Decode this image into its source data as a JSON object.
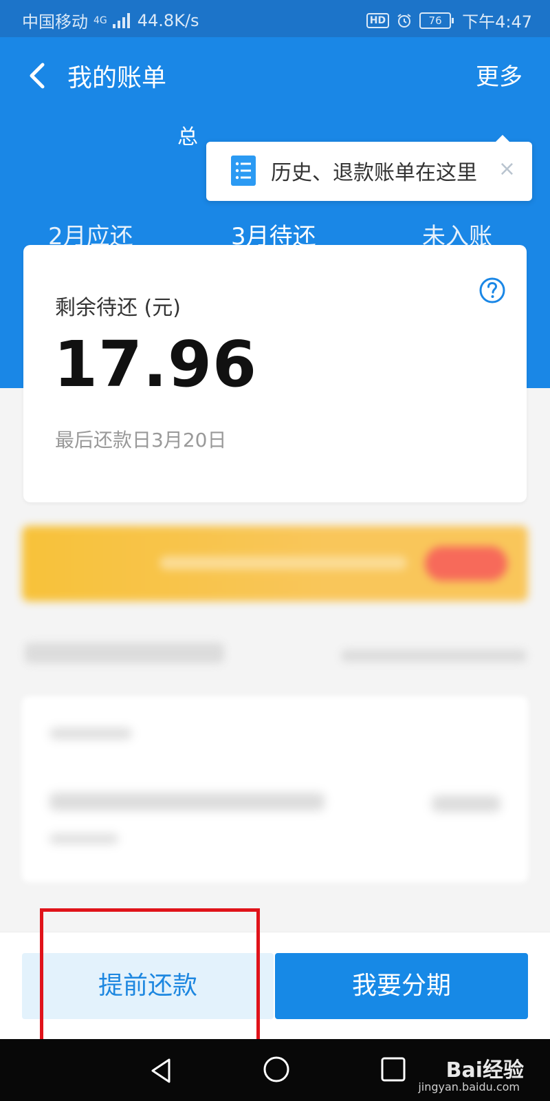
{
  "status_bar": {
    "carrier": "中国移动",
    "network": "4G",
    "speed": "44.8K/s",
    "hd": "HD",
    "battery": "76",
    "time": "下午4:47"
  },
  "header": {
    "title": "我的账单",
    "more": "更多",
    "total_fragment": "总"
  },
  "tooltip": {
    "text": "历史、退款账单在这里",
    "close": "×"
  },
  "tabs": [
    {
      "label": "2月应还"
    },
    {
      "label": "3月待还"
    },
    {
      "label": "未入账"
    }
  ],
  "card": {
    "remain_label": "剩余待还 (元)",
    "amount": "17.96",
    "due_date": "最后还款日3月20日"
  },
  "actions": {
    "prepay": "提前还款",
    "installment": "我要分期"
  },
  "watermark": {
    "brand": "Bai经验",
    "url": "jingyan.baidu.com"
  },
  "colors": {
    "primary": "#1a87e6",
    "highlight": "#e0131a",
    "prepay_bg": "#e3f2fc"
  }
}
